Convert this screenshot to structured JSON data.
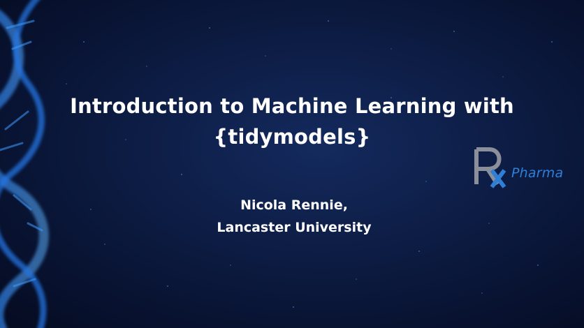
{
  "slide": {
    "title_line1": "Introduction to Machine Learning with",
    "title_line2": "{tidymodels}",
    "author_line1": "Nicola Rennie,",
    "author_line2": "Lancaster University"
  },
  "logo": {
    "text": "Pharma",
    "mark_color": "#8a8f99",
    "accent_color": "#2f7fd6"
  },
  "colors": {
    "background": "#0a1533",
    "dna_glow": "#2e8dff"
  }
}
